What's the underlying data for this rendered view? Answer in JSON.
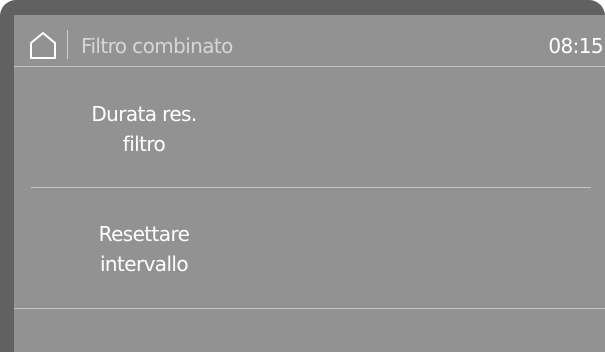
{
  "header": {
    "home_icon": "home-icon",
    "title": "Filtro combinato",
    "time": "08:15"
  },
  "menu": {
    "items": [
      {
        "line1": "Durata res.",
        "line2": "filtro"
      },
      {
        "line1": "Resettare",
        "line2": "intervallo"
      }
    ]
  },
  "colors": {
    "bezel": "#616161",
    "screen": "#929292",
    "text": "#ffffff",
    "title_text": "#d6d6d6",
    "divider": "#c4c4c4"
  }
}
